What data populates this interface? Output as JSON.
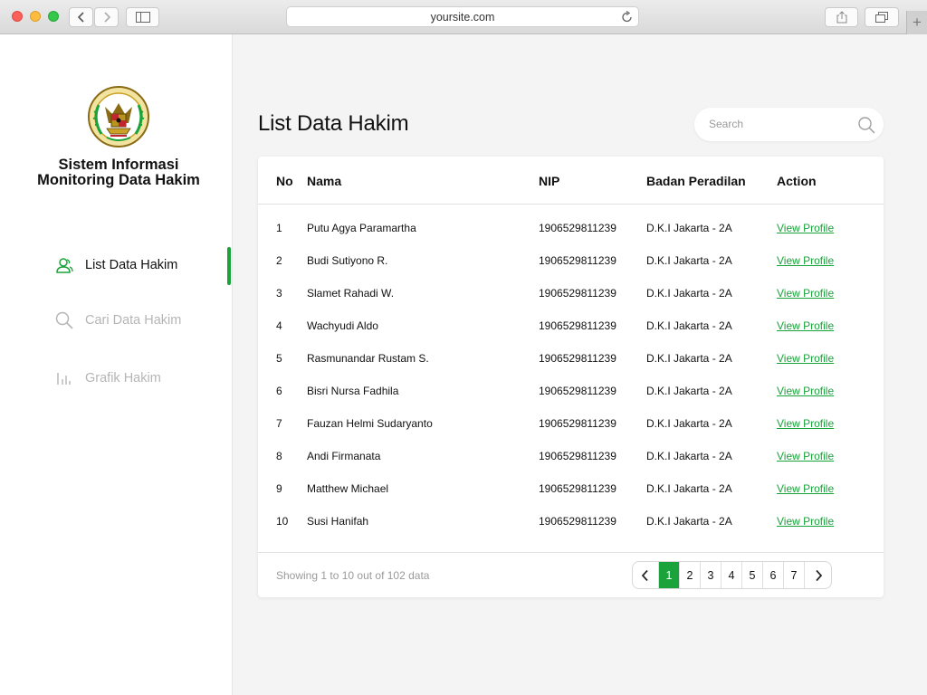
{
  "browser": {
    "url": "yoursite.com"
  },
  "sidebar": {
    "app_title_line1": "Sistem Informasi",
    "app_title_line2": "Monitoring Data Hakim",
    "items": [
      {
        "label": "List Data Hakim",
        "icon": "user-group-icon",
        "active": true
      },
      {
        "label": "Cari Data Hakim",
        "icon": "search-icon",
        "active": false
      },
      {
        "label": "Grafik Hakim",
        "icon": "bar-chart-icon",
        "active": false
      }
    ]
  },
  "main": {
    "title": "List Data Hakim",
    "search": {
      "placeholder": "Search",
      "value": ""
    },
    "table": {
      "columns": [
        "No",
        "Nama",
        "NIP",
        "Badan Peradilan",
        "Action"
      ],
      "rows": [
        {
          "no": "1",
          "nama": "Putu Agya Paramartha",
          "nip": "1906529811239",
          "badan": "D.K.I Jakarta - 2A",
          "action": "View Profile"
        },
        {
          "no": "2",
          "nama": "Budi Sutiyono R.",
          "nip": "1906529811239",
          "badan": "D.K.I Jakarta - 2A",
          "action": "View Profile"
        },
        {
          "no": "3",
          "nama": "Slamet Rahadi W.",
          "nip": "1906529811239",
          "badan": "D.K.I Jakarta - 2A",
          "action": "View Profile"
        },
        {
          "no": "4",
          "nama": "Wachyudi Aldo",
          "nip": "1906529811239",
          "badan": "D.K.I Jakarta - 2A",
          "action": "View Profile"
        },
        {
          "no": "5",
          "nama": "Rasmunandar Rustam S.",
          "nip": "1906529811239",
          "badan": "D.K.I Jakarta - 2A",
          "action": "View Profile"
        },
        {
          "no": "6",
          "nama": "Bisri Nursa Fadhila",
          "nip": "1906529811239",
          "badan": "D.K.I Jakarta - 2A",
          "action": "View Profile"
        },
        {
          "no": "7",
          "nama": "Fauzan Helmi Sudaryanto",
          "nip": "1906529811239",
          "badan": "D.K.I Jakarta - 2A",
          "action": "View Profile"
        },
        {
          "no": "8",
          "nama": "Andi Firmanata",
          "nip": "1906529811239",
          "badan": "D.K.I Jakarta - 2A",
          "action": "View Profile"
        },
        {
          "no": "9",
          "nama": "Matthew Michael",
          "nip": "1906529811239",
          "badan": "D.K.I Jakarta - 2A",
          "action": "View Profile"
        },
        {
          "no": "10",
          "nama": "Susi Hanifah",
          "nip": "1906529811239",
          "badan": "D.K.I Jakarta - 2A",
          "action": "View Profile"
        }
      ]
    },
    "footer": {
      "showing": "Showing 1 to 10 out of 102 data",
      "pages": [
        "1",
        "2",
        "3",
        "4",
        "5",
        "6",
        "7"
      ],
      "current_page": "1"
    }
  },
  "colors": {
    "accent": "#1aa33a",
    "muted": "#b5b5b5"
  }
}
